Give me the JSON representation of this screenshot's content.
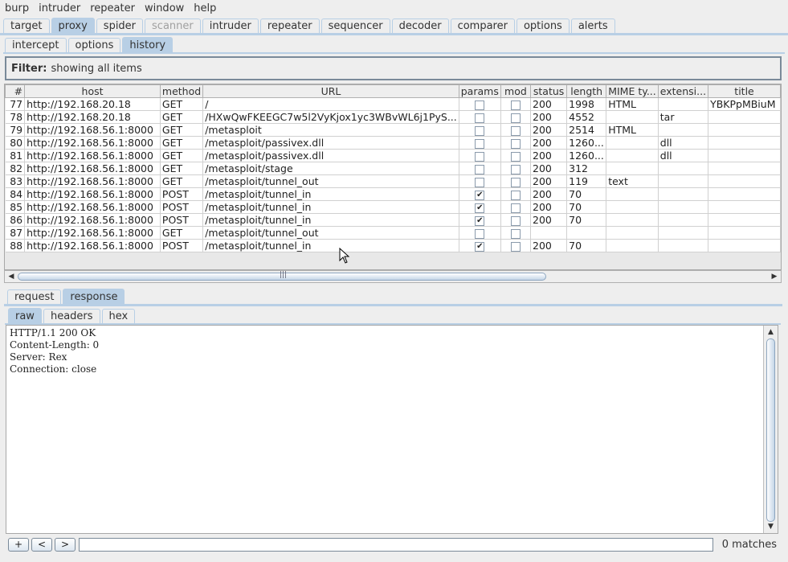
{
  "menu": [
    "burp",
    "intruder",
    "repeater",
    "window",
    "help"
  ],
  "main_tabs": [
    {
      "label": "target",
      "selected": false,
      "disabled": false
    },
    {
      "label": "proxy",
      "selected": true,
      "disabled": false
    },
    {
      "label": "spider",
      "selected": false,
      "disabled": false
    },
    {
      "label": "scanner",
      "selected": false,
      "disabled": true
    },
    {
      "label": "intruder",
      "selected": false,
      "disabled": false
    },
    {
      "label": "repeater",
      "selected": false,
      "disabled": false
    },
    {
      "label": "sequencer",
      "selected": false,
      "disabled": false
    },
    {
      "label": "decoder",
      "selected": false,
      "disabled": false
    },
    {
      "label": "comparer",
      "selected": false,
      "disabled": false
    },
    {
      "label": "options",
      "selected": false,
      "disabled": false
    },
    {
      "label": "alerts",
      "selected": false,
      "disabled": false
    }
  ],
  "proxy_tabs": [
    {
      "label": "intercept",
      "selected": false
    },
    {
      "label": "options",
      "selected": false
    },
    {
      "label": "history",
      "selected": true
    }
  ],
  "filter": {
    "label": "Filter:",
    "text": "showing all items"
  },
  "history_table": {
    "columns": [
      "#",
      "host",
      "method",
      "URL",
      "params",
      "mod",
      "status",
      "length",
      "MIME ty...",
      "extensi...",
      "title"
    ],
    "rows": [
      {
        "num": "77",
        "host": "http://192.168.20.18",
        "method": "GET",
        "url": "/",
        "params": false,
        "mod": false,
        "status": "200",
        "length": "1998",
        "mime": "HTML",
        "ext": "",
        "title": "YBKPpMBiuM"
      },
      {
        "num": "78",
        "host": "http://192.168.20.18",
        "method": "GET",
        "url": "/HXwQwFKEEGC7w5l2VyKjox1yc3WBvWL6j1PyS...",
        "params": false,
        "mod": false,
        "status": "200",
        "length": "4552",
        "mime": "",
        "ext": "tar",
        "title": ""
      },
      {
        "num": "79",
        "host": "http://192.168.56.1:8000",
        "method": "GET",
        "url": "/metasploit",
        "params": false,
        "mod": false,
        "status": "200",
        "length": "2514",
        "mime": "HTML",
        "ext": "",
        "title": ""
      },
      {
        "num": "80",
        "host": "http://192.168.56.1:8000",
        "method": "GET",
        "url": "/metasploit/passivex.dll",
        "params": false,
        "mod": false,
        "status": "200",
        "length": "1260...",
        "mime": "",
        "ext": "dll",
        "title": ""
      },
      {
        "num": "81",
        "host": "http://192.168.56.1:8000",
        "method": "GET",
        "url": "/metasploit/passivex.dll",
        "params": false,
        "mod": false,
        "status": "200",
        "length": "1260...",
        "mime": "",
        "ext": "dll",
        "title": ""
      },
      {
        "num": "82",
        "host": "http://192.168.56.1:8000",
        "method": "GET",
        "url": "/metasploit/stage",
        "params": false,
        "mod": false,
        "status": "200",
        "length": "312",
        "mime": "",
        "ext": "",
        "title": ""
      },
      {
        "num": "83",
        "host": "http://192.168.56.1:8000",
        "method": "GET",
        "url": "/metasploit/tunnel_out",
        "params": false,
        "mod": false,
        "status": "200",
        "length": "119",
        "mime": "text",
        "ext": "",
        "title": ""
      },
      {
        "num": "84",
        "host": "http://192.168.56.1:8000",
        "method": "POST",
        "url": "/metasploit/tunnel_in",
        "params": true,
        "mod": false,
        "status": "200",
        "length": "70",
        "mime": "",
        "ext": "",
        "title": ""
      },
      {
        "num": "85",
        "host": "http://192.168.56.1:8000",
        "method": "POST",
        "url": "/metasploit/tunnel_in",
        "params": true,
        "mod": false,
        "status": "200",
        "length": "70",
        "mime": "",
        "ext": "",
        "title": ""
      },
      {
        "num": "86",
        "host": "http://192.168.56.1:8000",
        "method": "POST",
        "url": "/metasploit/tunnel_in",
        "params": true,
        "mod": false,
        "status": "200",
        "length": "70",
        "mime": "",
        "ext": "",
        "title": ""
      },
      {
        "num": "87",
        "host": "http://192.168.56.1:8000",
        "method": "GET",
        "url": "/metasploit/tunnel_out",
        "params": false,
        "mod": false,
        "status": "",
        "length": "",
        "mime": "",
        "ext": "",
        "title": ""
      },
      {
        "num": "88",
        "host": "http://192.168.56.1:8000",
        "method": "POST",
        "url": "/metasploit/tunnel_in",
        "params": true,
        "mod": false,
        "status": "200",
        "length": "70",
        "mime": "",
        "ext": "",
        "title": ""
      }
    ]
  },
  "message_tabs": [
    {
      "label": "request",
      "selected": false
    },
    {
      "label": "response",
      "selected": true
    }
  ],
  "view_tabs": [
    {
      "label": "raw",
      "selected": true
    },
    {
      "label": "headers",
      "selected": false
    },
    {
      "label": "hex",
      "selected": false
    }
  ],
  "response_raw": "HTTP/1.1 200 OK\nContent-Length: 0\nServer: Rex\nConnection: close",
  "search": {
    "plus": "+",
    "prev": "<",
    "next": ">",
    "value": "",
    "matches": "0 matches"
  },
  "colors": {
    "tab_selected": "#b8cfe5",
    "background": "#eeeeee"
  }
}
